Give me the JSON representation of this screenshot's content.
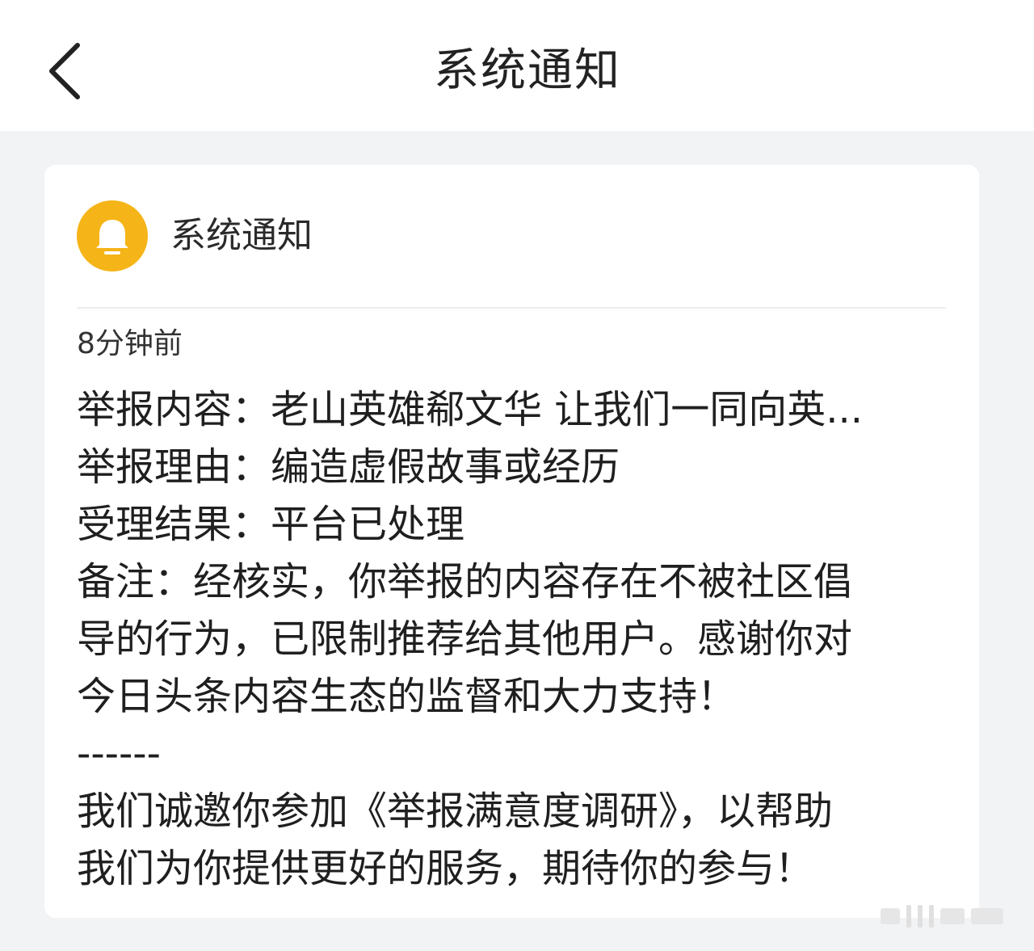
{
  "header": {
    "title": "系统通知"
  },
  "card": {
    "sender": "系统通知",
    "time": "8分钟前",
    "lines": [
      "举报内容：老山英雄郗文华 让我们一同向英...",
      "举报理由：编造虚假故事或经历",
      "受理结果：平台已处理",
      "备注：经核实，你举报的内容存在不被社区倡",
      "导的行为，已限制推荐给其他用户。感谢你对",
      "今日头条内容生态的监督和大力支持！",
      "------",
      "我们诚邀你参加《举报满意度调研》，以帮助",
      "我们为你提供更好的服务，期待你的参与！"
    ]
  },
  "colors": {
    "accent_bell": "#f5b417",
    "background": "#f2f3f5",
    "card": "#ffffff"
  }
}
